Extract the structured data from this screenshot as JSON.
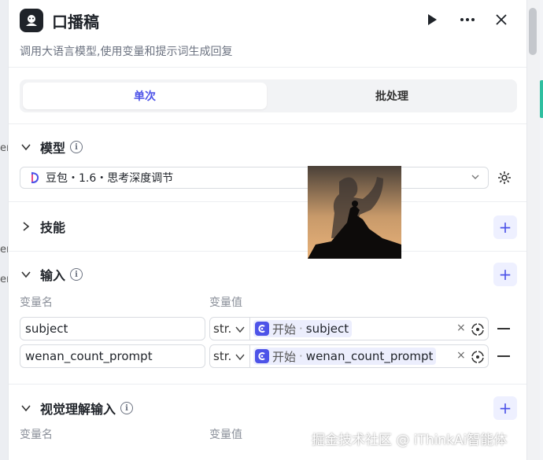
{
  "background": {
    "fragment_label": "er"
  },
  "header": {
    "title": "口播稿",
    "description": "调用大语言模型,使用变量和提示词生成回复"
  },
  "tabs": [
    {
      "label": "单次",
      "active": true
    },
    {
      "label": "批处理",
      "active": false
    }
  ],
  "sections": {
    "model": {
      "title": "模型",
      "selected_model": "豆包・1.6・思考深度调节"
    },
    "skills": {
      "title": "技能"
    },
    "input": {
      "title": "输入",
      "col_name": "变量名",
      "col_value": "变量值",
      "rows": [
        {
          "name": "subject",
          "type": "str.",
          "ref_source": "开始",
          "ref_var": "subject"
        },
        {
          "name": "wenan_count_prompt",
          "type": "str.",
          "ref_source": "开始",
          "ref_var": "wenan_count_prompt"
        }
      ]
    },
    "vision": {
      "title": "视觉理解输入",
      "col_name": "变量名",
      "col_value": "变量值"
    }
  },
  "watermark": "掘金技术社区 @ iThinkAi智能体",
  "colors": {
    "accent": "#4d53e8",
    "accent_light": "#eef0ff",
    "side_accent": "#2fbfa0"
  }
}
